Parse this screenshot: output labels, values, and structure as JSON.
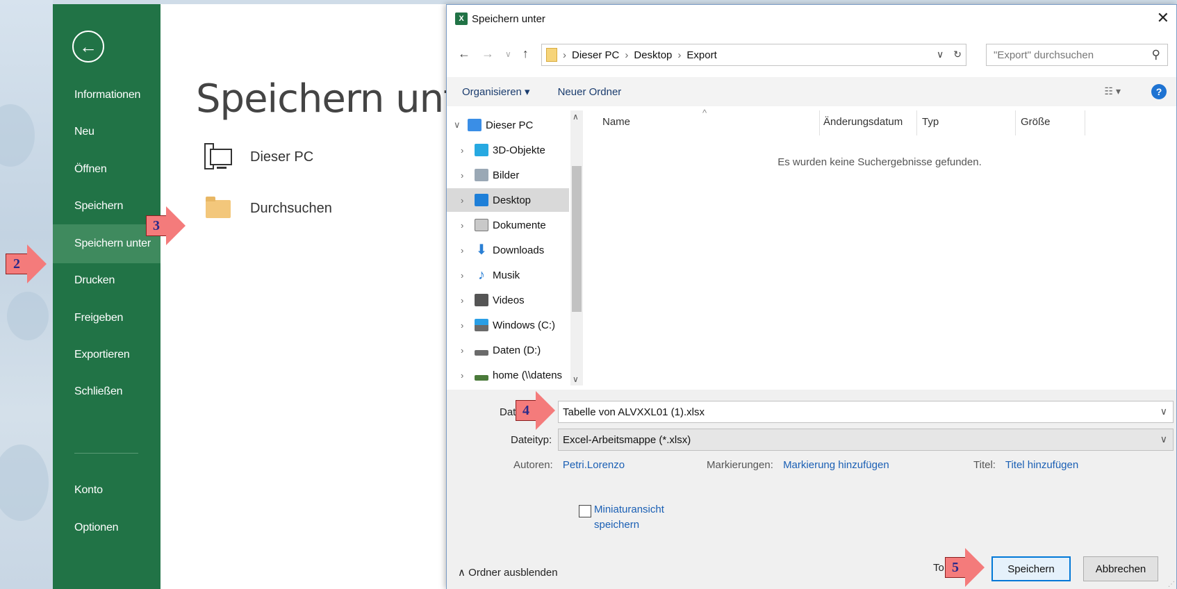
{
  "backstage": {
    "title": "Speichern unter",
    "nav": {
      "back_icon": "back-arrow-icon",
      "items": [
        {
          "label": "Informationen",
          "active": false
        },
        {
          "label": "Neu",
          "active": false
        },
        {
          "label": "Öffnen",
          "active": false
        },
        {
          "label": "Speichern",
          "active": false
        },
        {
          "label": "Speichern unter",
          "active": true
        },
        {
          "label": "Drucken",
          "active": false
        },
        {
          "label": "Freigeben",
          "active": false
        },
        {
          "label": "Exportieren",
          "active": false
        },
        {
          "label": "Schließen",
          "active": false
        },
        {
          "label": "Konto",
          "active": false
        },
        {
          "label": "Optionen",
          "active": false
        }
      ]
    },
    "locations": [
      {
        "label": "Dieser PC",
        "icon": "computer-icon"
      },
      {
        "label": "Durchsuchen",
        "icon": "folder-icon"
      }
    ]
  },
  "callouts": [
    "2",
    "3",
    "4",
    "5"
  ],
  "dialog": {
    "title": "Speichern unter",
    "app_icon": "X",
    "close": "✕",
    "address": {
      "crumbs": [
        "Dieser PC",
        "Desktop",
        "Export"
      ],
      "search_placeholder": "\"Export\" durchsuchen"
    },
    "toolbar": {
      "organize": "Organisieren ▾",
      "new_folder": "Neuer Ordner"
    },
    "tree": [
      {
        "label": "Dieser PC",
        "icon": "computer-icon",
        "expanded": true,
        "color": "#3a8ee6"
      },
      {
        "label": "3D-Objekte",
        "icon": "cube-3d-icon",
        "color": "#27a9e1"
      },
      {
        "label": "Bilder",
        "icon": "pictures-icon",
        "color": "#9aa8b5"
      },
      {
        "label": "Desktop",
        "icon": "desktop-icon",
        "color": "#1e7fd8",
        "selected": true
      },
      {
        "label": "Dokumente",
        "icon": "document-icon",
        "color": "#c9c9c9"
      },
      {
        "label": "Downloads",
        "icon": "download-icon",
        "color": "#2a7fd4"
      },
      {
        "label": "Musik",
        "icon": "music-icon",
        "color": "#2a7fd4"
      },
      {
        "label": "Videos",
        "icon": "video-icon",
        "color": "#555555"
      },
      {
        "label": "Windows (C:)",
        "icon": "drive-windows-icon",
        "color": "#6b6b6b"
      },
      {
        "label": "Daten (D:)",
        "icon": "drive-icon",
        "color": "#6b6b6b"
      },
      {
        "label": "home (\\\\datens",
        "icon": "network-drive-icon",
        "color": "#4a7a3a"
      }
    ],
    "columns": [
      "Name",
      "Änderungsdatum",
      "Typ",
      "Größe"
    ],
    "empty_message": "Es wurden keine Suchergebnisse gefunden.",
    "filename_label": "Dat",
    "filename_value": "Tabelle von ALVXXL01 (1).xlsx",
    "filetype_label": "Dateityp:",
    "filetype_value": "Excel-Arbeitsmappe (*.xlsx)",
    "authors_label": "Autoren:",
    "authors_value": "Petri.Lorenzo",
    "tags_label": "Markierungen:",
    "tags_value": "Markierung hinzufügen",
    "title_label": "Titel:",
    "title_value": "Titel hinzufügen",
    "thumbnail_label": "Miniaturansicht speichern",
    "hide_folders": "Ordner ausblenden",
    "tools_label": "To",
    "save_button": "Speichern",
    "cancel_button": "Abbrechen"
  }
}
